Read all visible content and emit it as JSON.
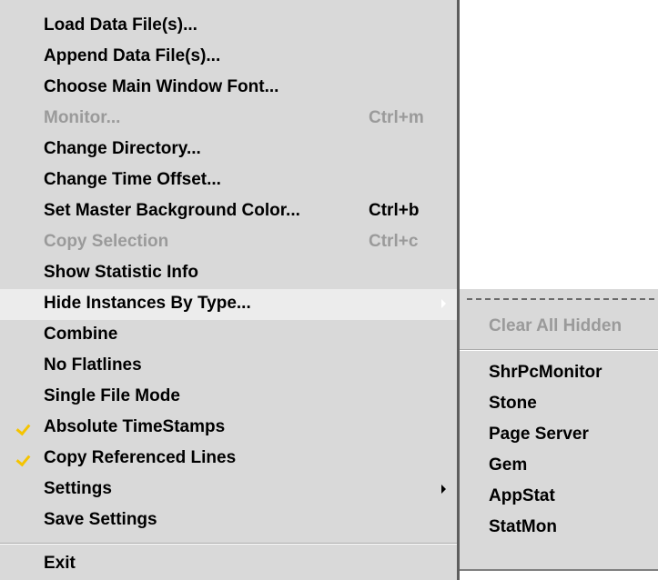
{
  "menu": {
    "items": [
      {
        "label": "Load Data File(s)..."
      },
      {
        "label": "Append Data File(s)..."
      },
      {
        "label": "Choose Main Window Font..."
      },
      {
        "label": "Monitor...",
        "shortcut": "Ctrl+m",
        "disabled": true
      },
      {
        "label": "Change Directory..."
      },
      {
        "label": "Change Time Offset..."
      },
      {
        "label": "Set Master Background Color...",
        "shortcut": "Ctrl+b"
      },
      {
        "label": "Copy Selection",
        "shortcut": "Ctrl+c",
        "disabled": true
      },
      {
        "label": "Show Statistic Info"
      },
      {
        "label": "Hide Instances By Type...",
        "submenu": true,
        "active": true
      },
      {
        "label": "Combine"
      },
      {
        "label": "No Flatlines"
      },
      {
        "label": "Single File Mode"
      },
      {
        "label": "Absolute TimeStamps",
        "checked": true
      },
      {
        "label": "Copy Referenced Lines",
        "checked": true
      },
      {
        "label": "Settings",
        "submenu": true
      },
      {
        "label": "Save Settings"
      },
      {
        "label": "Exit"
      }
    ],
    "check_color": "#f5c400"
  },
  "submenu": {
    "clear_label": "Clear All Hidden",
    "items": [
      "ShrPcMonitor",
      "Stone",
      "Page Server",
      "Gem",
      "AppStat",
      "StatMon"
    ]
  }
}
